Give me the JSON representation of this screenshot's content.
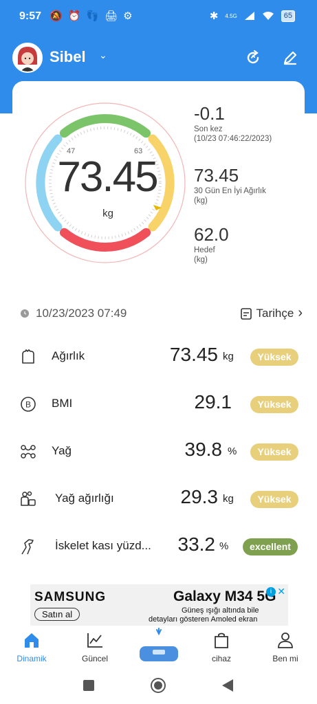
{
  "status_bar": {
    "time": "9:57",
    "network": "4.5G",
    "battery": "65"
  },
  "header": {
    "user_name": "Sibel"
  },
  "card": {
    "weight_value": "73.45",
    "weight_unit": "kg",
    "gauge_min_tick": "47",
    "gauge_max_tick": "63",
    "stats": [
      {
        "value": "-0.1",
        "label": "Son kez",
        "sub": "(10/23 07:46:22/2023)"
      },
      {
        "value": "73.45",
        "label": "30 Gün En İyi Ağırlık",
        "sub": "(kg)"
      },
      {
        "value": "62.0",
        "label": "Hedef",
        "sub": "(kg)"
      }
    ]
  },
  "date_row": {
    "datetime": "10/23/2023 07:49",
    "history_label": "Tarihçe"
  },
  "metrics": [
    {
      "name": "Ağırlık",
      "value": "73.45",
      "unit": "kg",
      "badge": "Yüksek",
      "icon": "weight-icon"
    },
    {
      "name": "BMI",
      "value": "29.1",
      "unit": "",
      "badge": "Yüksek",
      "icon": "bmi-icon"
    },
    {
      "name": "Yağ",
      "value": "39.8",
      "unit": "%",
      "badge": "Yüksek",
      "icon": "fat-icon"
    },
    {
      "name": "Yağ ağırlığı",
      "value": "29.3",
      "unit": "kg",
      "badge": "Yüksek",
      "icon": "fat-weight-icon"
    },
    {
      "name": "İskelet kası yüzd...",
      "value": "33.2",
      "unit": "%",
      "badge": "excellent",
      "icon": "muscle-icon"
    }
  ],
  "ad": {
    "brand": "SAMSUNG",
    "cta": "Satın al",
    "product": "Galaxy M34 5G",
    "line1": "Güneş ışığı altında bile",
    "line2": "detayları gösteren Amoled ekran"
  },
  "nav": [
    {
      "label": "Dinamik",
      "icon": "home-icon",
      "active": true
    },
    {
      "label": "Güncel",
      "icon": "chart-icon",
      "active": false
    },
    {
      "label": "cihaz",
      "icon": "bag-icon",
      "active": false
    },
    {
      "label": "Ben mi",
      "icon": "person-icon",
      "active": false
    }
  ],
  "colors": {
    "primary": "#2f8cea",
    "badge_high": "#e8cf7c",
    "badge_good": "#7fa14f",
    "gauge_green": "#7cc46a",
    "gauge_yellow": "#f7d36a",
    "gauge_red": "#f0505a",
    "gauge_blue": "#8fd3f2"
  }
}
